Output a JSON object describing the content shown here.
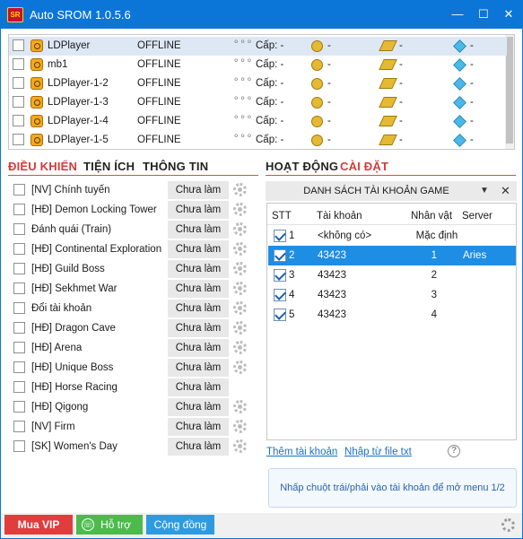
{
  "window": {
    "title": "Auto SROM 1.0.5.6",
    "logo_text": "SR",
    "min": "—",
    "max": "☐",
    "close": "✕"
  },
  "devices": [
    {
      "name": "LDPlayer",
      "status": "OFFLINE",
      "menu": "⚬⚬⚬",
      "level": "Cấp: -",
      "gold": "-",
      "power": "-",
      "gem": "-"
    },
    {
      "name": "mb1",
      "status": "OFFLINE",
      "menu": "⚬⚬⚬",
      "level": "Cấp: -",
      "gold": "-",
      "power": "-",
      "gem": "-"
    },
    {
      "name": "LDPlayer-1-2",
      "status": "OFFLINE",
      "menu": "⚬⚬⚬",
      "level": "Cấp: -",
      "gold": "-",
      "power": "-",
      "gem": "-"
    },
    {
      "name": "LDPlayer-1-3",
      "status": "OFFLINE",
      "menu": "⚬⚬⚬",
      "level": "Cấp: -",
      "gold": "-",
      "power": "-",
      "gem": "-"
    },
    {
      "name": "LDPlayer-1-4",
      "status": "OFFLINE",
      "menu": "⚬⚬⚬",
      "level": "Cấp: -",
      "gold": "-",
      "power": "-",
      "gem": "-"
    },
    {
      "name": "LDPlayer-1-5",
      "status": "OFFLINE",
      "menu": "⚬⚬⚬",
      "level": "Cấp: -",
      "gold": "-",
      "power": "-",
      "gem": "-"
    }
  ],
  "left_tabs": [
    "ĐIỀU KHIỂN",
    "TIỆN ÍCH",
    "THÔNG TIN"
  ],
  "right_tabs": [
    "HOẠT ĐỘNG",
    "CÀI ĐẶT"
  ],
  "colors": {
    "active_tab": "#d63a3a",
    "tab": "#222222",
    "titlebar": "#0c76d8",
    "selection": "#1e8de4"
  },
  "tasks": [
    {
      "label": "[NV] Chính tuyến",
      "button": "Chưa làm",
      "gear": true
    },
    {
      "label": "[HĐ] Demon Locking Tower",
      "button": "Chưa làm",
      "gear": true
    },
    {
      "label": "Đánh quái (Train)",
      "button": "Chưa làm",
      "gear": true
    },
    {
      "label": "[HĐ] Continental Exploration",
      "button": "Chưa làm",
      "gear": true
    },
    {
      "label": "[HĐ] Guild Boss",
      "button": "Chưa làm",
      "gear": true
    },
    {
      "label": "[HĐ] Sekhmet War",
      "button": "Chưa làm",
      "gear": true
    },
    {
      "label": "Đổi tài khoản",
      "button": "Chưa làm",
      "gear": true
    },
    {
      "label": "[HĐ] Dragon Cave",
      "button": "Chưa làm",
      "gear": true
    },
    {
      "label": "[HĐ] Arena",
      "button": "Chưa làm",
      "gear": true
    },
    {
      "label": "[HĐ] Unique Boss",
      "button": "Chưa làm",
      "gear": true
    },
    {
      "label": "[HĐ] Horse Racing",
      "button": "Chưa làm",
      "gear": false
    },
    {
      "label": "[HĐ] Qigong",
      "button": "Chưa làm",
      "gear": true
    },
    {
      "label": "[NV] Firm",
      "button": "Chưa làm",
      "gear": true
    },
    {
      "label": "[SK] Women's Day",
      "button": "Chưa làm",
      "gear": true
    }
  ],
  "accounts": {
    "header": "DANH SÁCH TÀI KHOẢN GAME",
    "caret": "▼",
    "close": "✕",
    "columns": [
      "STT",
      "Tài khoản",
      "Nhân vật",
      "Server"
    ],
    "rows": [
      {
        "stt": "1",
        "account": "<không có>",
        "character": "Mặc định",
        "server": ""
      },
      {
        "stt": "2",
        "account": "43423",
        "character": "1",
        "server": "Aries"
      },
      {
        "stt": "3",
        "account": "43423",
        "character": "2",
        "server": ""
      },
      {
        "stt": "4",
        "account": "43423",
        "character": "3",
        "server": ""
      },
      {
        "stt": "5",
        "account": "43423",
        "character": "4",
        "server": ""
      }
    ]
  },
  "links": {
    "add": "Thêm tài khoản",
    "import": "Nhập từ file txt",
    "help": "?"
  },
  "hint": "Nhấp chuột trái/phải vào tài khoản để mở menu 1/2",
  "bottom": {
    "vip": "Mua VIP",
    "support": "Hỗ trợ",
    "community": "Cộng đồng",
    "phone": "☏"
  }
}
